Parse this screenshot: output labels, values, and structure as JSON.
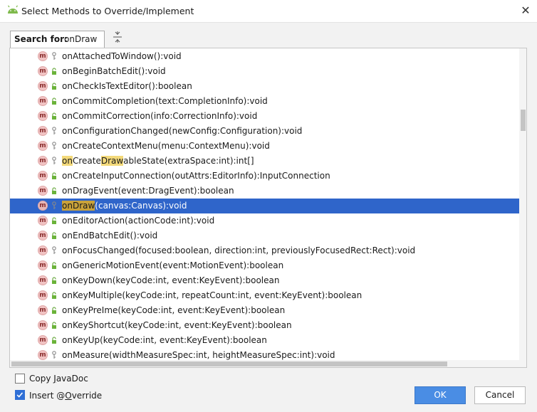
{
  "window": {
    "title": "Select Methods to Override/Implement",
    "close_glyph": "✕"
  },
  "search": {
    "label": "Search for:",
    "value": "onDraw"
  },
  "rows": [
    {
      "pre": "",
      "hl": "",
      "post": "onAttachedToWindow():void",
      "vis": "key"
    },
    {
      "pre": "",
      "hl": "",
      "post": "onBeginBatchEdit():void",
      "vis": "lock"
    },
    {
      "pre": "",
      "hl": "",
      "post": "onCheckIsTextEditor():boolean",
      "vis": "lock"
    },
    {
      "pre": "",
      "hl": "",
      "post": "onCommitCompletion(text:CompletionInfo):void",
      "vis": "lock"
    },
    {
      "pre": "",
      "hl": "",
      "post": "onCommitCorrection(info:CorrectionInfo):void",
      "vis": "lock"
    },
    {
      "pre": "",
      "hl": "",
      "post": "onConfigurationChanged(newConfig:Configuration):void",
      "vis": "key"
    },
    {
      "pre": "",
      "hl": "",
      "post": "onCreateContextMenu(menu:ContextMenu):void",
      "vis": "key"
    },
    {
      "pre": "",
      "hl": "on",
      "mid": "Create",
      "hl2": "Draw",
      "post": "ableState(extraSpace:int):int[]",
      "vis": "key"
    },
    {
      "pre": "",
      "hl": "",
      "post": "onCreateInputConnection(outAttrs:EditorInfo):InputConnection",
      "vis": "lock"
    },
    {
      "pre": "",
      "hl": "",
      "post": "onDragEvent(event:DragEvent):boolean",
      "vis": "lock"
    },
    {
      "pre": "",
      "hl": "onDraw",
      "post": "(canvas:Canvas):void",
      "vis": "key",
      "selected": true
    },
    {
      "pre": "",
      "hl": "",
      "post": "onEditorAction(actionCode:int):void",
      "vis": "lock"
    },
    {
      "pre": "",
      "hl": "",
      "post": "onEndBatchEdit():void",
      "vis": "lock"
    },
    {
      "pre": "",
      "hl": "",
      "post": "onFocusChanged(focused:boolean, direction:int, previouslyFocusedRect:Rect):void",
      "vis": "key"
    },
    {
      "pre": "",
      "hl": "",
      "post": "onGenericMotionEvent(event:MotionEvent):boolean",
      "vis": "lock"
    },
    {
      "pre": "",
      "hl": "",
      "post": "onKeyDown(keyCode:int, event:KeyEvent):boolean",
      "vis": "lock"
    },
    {
      "pre": "",
      "hl": "",
      "post": "onKeyMultiple(keyCode:int, repeatCount:int, event:KeyEvent):boolean",
      "vis": "lock"
    },
    {
      "pre": "",
      "hl": "",
      "post": "onKeyPreIme(keyCode:int, event:KeyEvent):boolean",
      "vis": "lock"
    },
    {
      "pre": "",
      "hl": "",
      "post": "onKeyShortcut(keyCode:int, event:KeyEvent):boolean",
      "vis": "lock"
    },
    {
      "pre": "",
      "hl": "",
      "post": "onKeyUp(keyCode:int, event:KeyEvent):boolean",
      "vis": "lock"
    },
    {
      "pre": "",
      "hl": "",
      "post": "onMeasure(widthMeasureSpec:int, heightMeasureSpec:int):void",
      "vis": "key"
    }
  ],
  "method_badge": "m",
  "options": {
    "copy_javadoc": {
      "label_pre": "Copy ",
      "label_mn": "J",
      "label_post": "avaDoc",
      "checked": false
    },
    "insert_override": {
      "label_pre": "Insert @",
      "label_mn": "O",
      "label_post": "verride",
      "checked": true
    }
  },
  "buttons": {
    "ok": "OK",
    "cancel": "Cancel"
  },
  "colors": {
    "selection": "#2f65ca",
    "ok_button": "#4a8de4",
    "match_highlight": "#f3d97a",
    "android_green": "#7fba4c"
  }
}
